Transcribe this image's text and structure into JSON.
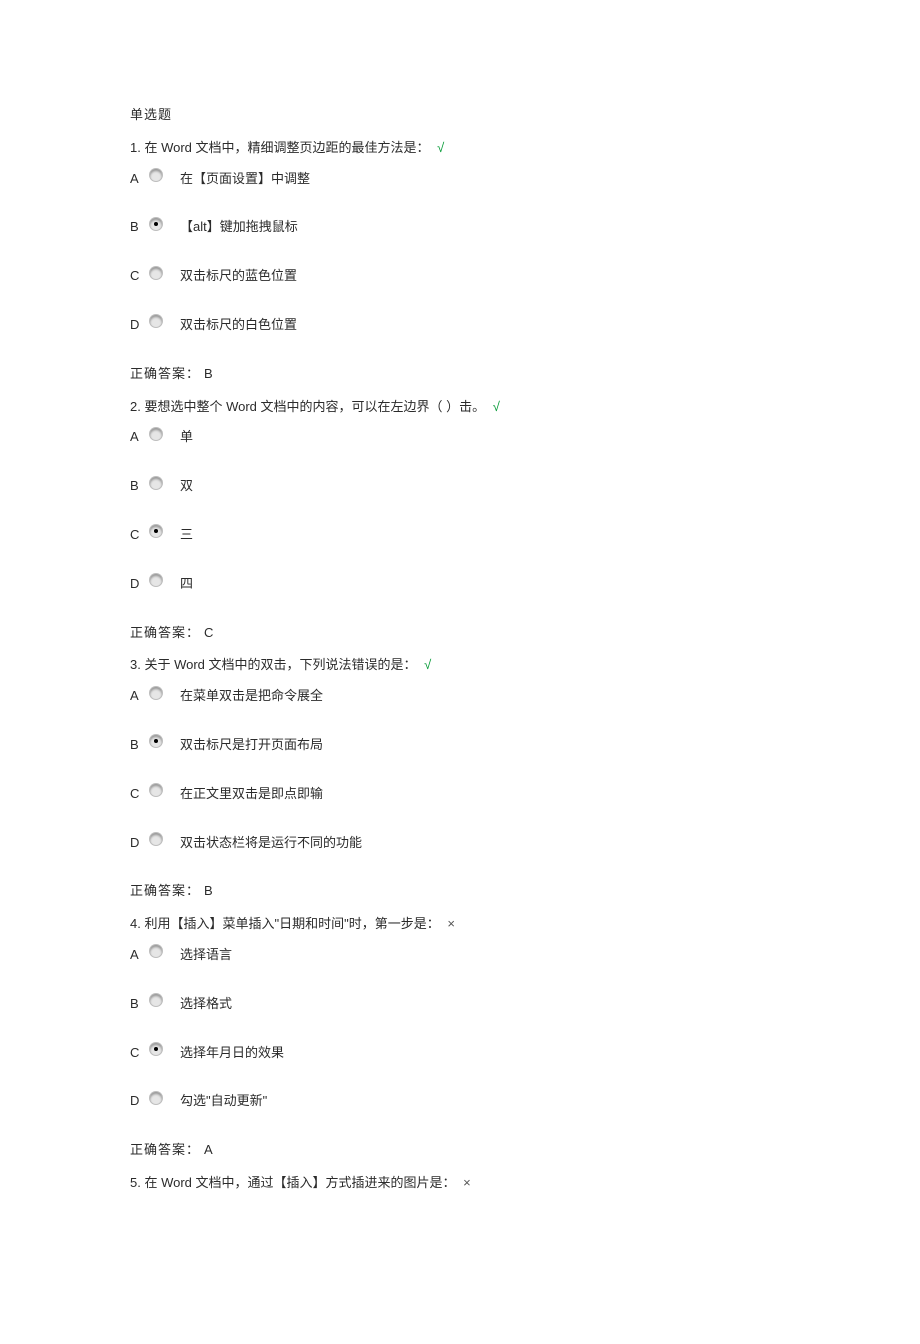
{
  "section_title": "单选题",
  "answer_label": "正确答案：",
  "marks": {
    "correct": "√",
    "wrong": "×"
  },
  "questions": [
    {
      "num": 1,
      "stem": "在 Word 文档中，精细调整页边距的最佳方法是：",
      "mark": "correct",
      "selected": "B",
      "answer": "B",
      "options": {
        "A": "在【页面设置】中调整",
        "B": "【alt】键加拖拽鼠标",
        "C": "双击标尺的蓝色位置",
        "D": "双击标尺的白色位置"
      }
    },
    {
      "num": 2,
      "stem": "要想选中整个 Word 文档中的内容，可以在左边界（ ）击。",
      "mark": "correct",
      "selected": "C",
      "answer": "C",
      "options": {
        "A": "单",
        "B": "双",
        "C": "三",
        "D": "四"
      }
    },
    {
      "num": 3,
      "stem": "关于 Word 文档中的双击，下列说法错误的是：",
      "mark": "correct",
      "selected": "B",
      "answer": "B",
      "options": {
        "A": "在菜单双击是把命令展全",
        "B": "双击标尺是打开页面布局",
        "C": "在正文里双击是即点即输",
        "D": "双击状态栏将是运行不同的功能"
      }
    },
    {
      "num": 4,
      "stem": "利用【插入】菜单插入\"日期和时间\"时，第一步是：",
      "mark": "wrong",
      "selected": "C",
      "answer": "A",
      "options": {
        "A": "选择语言",
        "B": "选择格式",
        "C": "选择年月日的效果",
        "D": "勾选\"自动更新\""
      }
    },
    {
      "num": 5,
      "stem": "在 Word 文档中，通过【插入】方式插进来的图片是：",
      "mark": "wrong",
      "selected": null,
      "answer": null,
      "options": {}
    }
  ]
}
